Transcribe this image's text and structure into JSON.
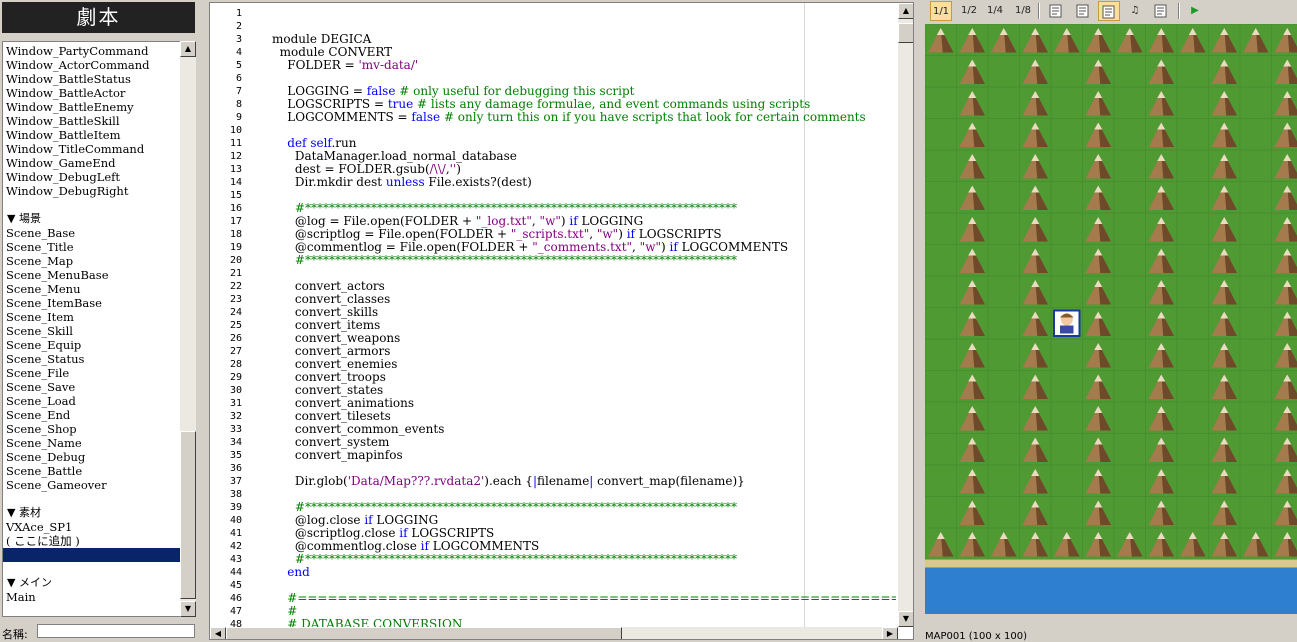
{
  "left_panel": {
    "title": "劇本",
    "items": [
      {
        "text": "Window_PartyCommand",
        "kind": "item"
      },
      {
        "text": "Window_ActorCommand",
        "kind": "item"
      },
      {
        "text": "Window_BattleStatus",
        "kind": "item"
      },
      {
        "text": "Window_BattleActor",
        "kind": "item"
      },
      {
        "text": "Window_BattleEnemy",
        "kind": "item"
      },
      {
        "text": "Window_BattleSkill",
        "kind": "item"
      },
      {
        "text": "Window_BattleItem",
        "kind": "item"
      },
      {
        "text": "Window_TitleCommand",
        "kind": "item"
      },
      {
        "text": "Window_GameEnd",
        "kind": "item"
      },
      {
        "text": "Window_DebugLeft",
        "kind": "item"
      },
      {
        "text": "Window_DebugRight",
        "kind": "item"
      },
      {
        "text": "",
        "kind": "blank"
      },
      {
        "text": "▼ 場景",
        "kind": "section"
      },
      {
        "text": "Scene_Base",
        "kind": "item"
      },
      {
        "text": "Scene_Title",
        "kind": "item"
      },
      {
        "text": "Scene_Map",
        "kind": "item"
      },
      {
        "text": "Scene_MenuBase",
        "kind": "item"
      },
      {
        "text": "Scene_Menu",
        "kind": "item"
      },
      {
        "text": "Scene_ItemBase",
        "kind": "item"
      },
      {
        "text": "Scene_Item",
        "kind": "item"
      },
      {
        "text": "Scene_Skill",
        "kind": "item"
      },
      {
        "text": "Scene_Equip",
        "kind": "item"
      },
      {
        "text": "Scene_Status",
        "kind": "item"
      },
      {
        "text": "Scene_File",
        "kind": "item"
      },
      {
        "text": "Scene_Save",
        "kind": "item"
      },
      {
        "text": "Scene_Load",
        "kind": "item"
      },
      {
        "text": "Scene_End",
        "kind": "item"
      },
      {
        "text": "Scene_Shop",
        "kind": "item"
      },
      {
        "text": "Scene_Name",
        "kind": "item"
      },
      {
        "text": "Scene_Debug",
        "kind": "item"
      },
      {
        "text": "Scene_Battle",
        "kind": "item"
      },
      {
        "text": "Scene_Gameover",
        "kind": "item"
      },
      {
        "text": "",
        "kind": "blank"
      },
      {
        "text": "▼ 素材",
        "kind": "section"
      },
      {
        "text": "VXAce_SP1",
        "kind": "item"
      },
      {
        "text": "( ここに追加 )",
        "kind": "item"
      },
      {
        "text": "",
        "kind": "selected"
      },
      {
        "text": "",
        "kind": "blank"
      },
      {
        "text": "▼ メイン",
        "kind": "section"
      },
      {
        "text": "Main",
        "kind": "item"
      }
    ],
    "name_label": "名稱:",
    "name_value": ""
  },
  "editor": {
    "lines": [
      [],
      [],
      [
        [
          "module DEGICA",
          ""
        ]
      ],
      [
        [
          "  module CONVERT",
          ""
        ]
      ],
      [
        [
          "    FOLDER = ",
          ""
        ],
        [
          "'mv-data/'",
          "str"
        ]
      ],
      [],
      [
        [
          "    LOGGING = ",
          ""
        ],
        [
          "false",
          "kw"
        ],
        [
          " # only useful for debugging this script",
          "cmt"
        ]
      ],
      [
        [
          "    LOGSCRIPTS = ",
          ""
        ],
        [
          "true",
          "kw"
        ],
        [
          " # lists any damage formulae, and event commands using scripts",
          "cmt"
        ]
      ],
      [
        [
          "    LOGCOMMENTS = ",
          ""
        ],
        [
          "false",
          "kw"
        ],
        [
          " # only turn this on if you have scripts that look for certain comments",
          "cmt"
        ]
      ],
      [],
      [
        [
          "    ",
          ""
        ],
        [
          "def",
          "kw"
        ],
        [
          " ",
          ""
        ],
        [
          "self",
          "kw"
        ],
        [
          ".run",
          ""
        ]
      ],
      [
        [
          "      DataManager.load_normal_database",
          ""
        ]
      ],
      [
        [
          "      dest = FOLDER.gsub(",
          ""
        ],
        [
          "/\\\\/",
          "str"
        ],
        [
          ",",
          ""
        ],
        [
          "''",
          "str"
        ],
        [
          ")",
          ""
        ]
      ],
      [
        [
          "      Dir.mkdir dest ",
          ""
        ],
        [
          "unless",
          "kw"
        ],
        [
          " File.exists?(dest)",
          ""
        ]
      ],
      [],
      [
        [
          "      #************************************************************************",
          "cmt"
        ]
      ],
      [
        [
          "      @log = File.open(FOLDER + ",
          ""
        ],
        [
          "\"_log.txt\"",
          "str"
        ],
        [
          ", ",
          ""
        ],
        [
          "\"w\"",
          "str"
        ],
        [
          ") ",
          ""
        ],
        [
          "if",
          "kw"
        ],
        [
          " LOGGING",
          ""
        ]
      ],
      [
        [
          "      @scriptlog = File.open(FOLDER + ",
          ""
        ],
        [
          "\"_scripts.txt\"",
          "str"
        ],
        [
          ", ",
          ""
        ],
        [
          "\"w\"",
          "str"
        ],
        [
          ") ",
          ""
        ],
        [
          "if",
          "kw"
        ],
        [
          " LOGSCRIPTS",
          ""
        ]
      ],
      [
        [
          "      @commentlog = File.open(FOLDER + ",
          ""
        ],
        [
          "\"_comments.txt\"",
          "str"
        ],
        [
          ", ",
          ""
        ],
        [
          "\"w\"",
          "str"
        ],
        [
          ") ",
          ""
        ],
        [
          "if",
          "kw"
        ],
        [
          " LOGCOMMENTS",
          ""
        ]
      ],
      [
        [
          "      #************************************************************************",
          "cmt"
        ]
      ],
      [],
      [
        [
          "      convert_actors",
          ""
        ]
      ],
      [
        [
          "      convert_classes",
          ""
        ]
      ],
      [
        [
          "      convert_skills",
          ""
        ]
      ],
      [
        [
          "      convert_items",
          ""
        ]
      ],
      [
        [
          "      convert_weapons",
          ""
        ]
      ],
      [
        [
          "      convert_armors",
          ""
        ]
      ],
      [
        [
          "      convert_enemies",
          ""
        ]
      ],
      [
        [
          "      convert_troops",
          ""
        ]
      ],
      [
        [
          "      convert_states",
          ""
        ]
      ],
      [
        [
          "      convert_animations",
          ""
        ]
      ],
      [
        [
          "      convert_tilesets",
          ""
        ]
      ],
      [
        [
          "      convert_common_events",
          ""
        ]
      ],
      [
        [
          "      convert_system",
          ""
        ]
      ],
      [
        [
          "      convert_mapinfos",
          ""
        ]
      ],
      [],
      [
        [
          "      Dir.glob(",
          ""
        ],
        [
          "'Data/Map???.rvdata2'",
          "str"
        ],
        [
          ").each {",
          ""
        ],
        [
          "|",
          "op"
        ],
        [
          "filename",
          ""
        ],
        [
          "|",
          "op"
        ],
        [
          " convert_map(filename)}",
          ""
        ]
      ],
      [],
      [
        [
          "      #************************************************************************",
          "cmt"
        ]
      ],
      [
        [
          "      @log.close ",
          ""
        ],
        [
          "if",
          "kw"
        ],
        [
          " LOGGING",
          ""
        ]
      ],
      [
        [
          "      @scriptlog.close ",
          ""
        ],
        [
          "if",
          "kw"
        ],
        [
          " LOGSCRIPTS",
          ""
        ]
      ],
      [
        [
          "      @commentlog.close ",
          ""
        ],
        [
          "if",
          "kw"
        ],
        [
          " LOGCOMMENTS",
          ""
        ]
      ],
      [
        [
          "      #************************************************************************",
          "cmt"
        ]
      ],
      [
        [
          "    ",
          ""
        ],
        [
          "end",
          "kw"
        ]
      ],
      [],
      [
        [
          "    #=========================================================================",
          "cmt"
        ]
      ],
      [
        [
          "    #",
          "cmt"
        ]
      ],
      [
        [
          "    # DATABASE CONVERSION",
          "cmt"
        ]
      ]
    ]
  },
  "map_panel": {
    "toolbar": [
      {
        "label": "1/1",
        "icon": "zoom-1-1-icon",
        "active": true
      },
      {
        "label": "1/2",
        "icon": "zoom-1-2-icon",
        "active": false
      },
      {
        "label": "1/4",
        "icon": "zoom-1-4-icon",
        "active": false
      },
      {
        "label": "1/8",
        "icon": "zoom-1-8-icon",
        "active": false
      },
      {
        "label": "",
        "icon": "database-icon",
        "active": false
      },
      {
        "label": "",
        "icon": "resource-manager-icon",
        "active": false
      },
      {
        "label": "",
        "icon": "script-editor-icon",
        "active": true
      },
      {
        "label": "♫",
        "icon": "sound-test-icon",
        "active": false
      },
      {
        "label": "",
        "icon": "character-generator-icon",
        "active": false
      },
      {
        "label": "▶",
        "icon": "playtest-icon",
        "active": false
      }
    ],
    "status": "MAP001 (100 x 100)"
  },
  "colors": {
    "grass": "#4f9a33",
    "grass_dark": "#3f7f2a",
    "mountain": "#a57a4c",
    "mountain_shadow": "#6e4a2a",
    "water": "#2f7fd0",
    "shore": "#d9c98a",
    "selection": "#0a246a",
    "keyword": "#0000ff",
    "string": "#800080",
    "comment": "#008000"
  }
}
